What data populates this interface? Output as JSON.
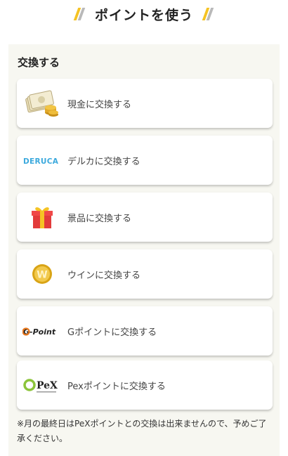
{
  "header": {
    "title": "ポイントを使う"
  },
  "section": {
    "title": "交換する"
  },
  "options": [
    {
      "label": "現金に交換する",
      "icon": "cash-icon"
    },
    {
      "label": "デルカに交換する",
      "icon": "deruca-logo",
      "logo_text": "DERUCA"
    },
    {
      "label": "景品に交換する",
      "icon": "gift-icon"
    },
    {
      "label": "ウインに交換する",
      "icon": "win-coin-icon",
      "logo_text": "W"
    },
    {
      "label": "Gポイントに交換する",
      "icon": "gpoint-logo",
      "logo_text": "G-Point"
    },
    {
      "label": "Pexポイントに交換する",
      "icon": "pex-logo",
      "logo_text": "PeX"
    }
  ],
  "note": "※月の最終日はPeXポイントとの交換は出来ませんので、予めご了承ください。",
  "colors": {
    "accent": "#f5c324",
    "panel_bg": "#f7f7f1"
  }
}
